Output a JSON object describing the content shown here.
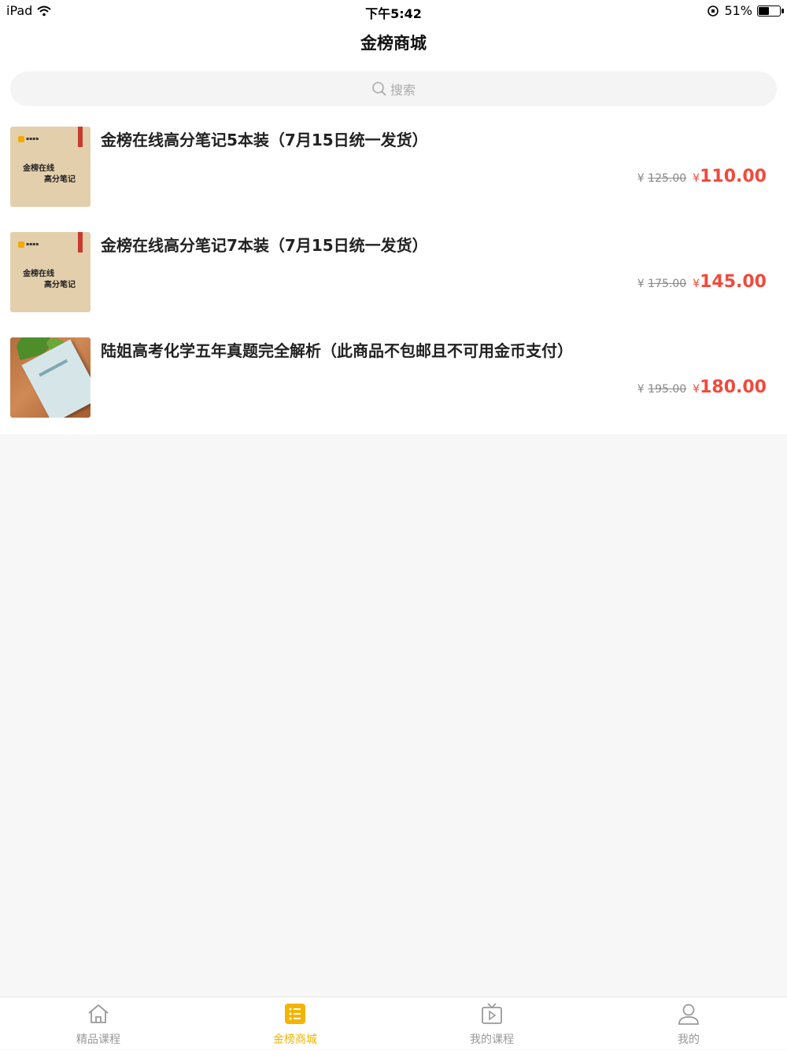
{
  "status_bar": {
    "device": "iPad",
    "time": "下午5:42",
    "battery": "51%",
    "battery_level": 0.51
  },
  "nav": {
    "title": "金榜商城"
  },
  "search": {
    "placeholder": "搜索"
  },
  "products": [
    {
      "title": "金榜在线高分笔记5本装（7月15日统一发货）",
      "currency": "¥",
      "old_price": "125.00",
      "price": "110.00",
      "thumb": {
        "line1": "金榜在线",
        "line2": "高分笔记"
      }
    },
    {
      "title": "金榜在线高分笔记7本装（7月15日统一发货）",
      "currency": "¥",
      "old_price": "175.00",
      "price": "145.00",
      "thumb": {
        "line1": "金榜在线",
        "line2": "高分笔记"
      }
    },
    {
      "title": "陆姐高考化学五年真题完全解析（此商品不包邮且不可用金币支付）",
      "currency": "¥",
      "old_price": "195.00",
      "price": "180.00"
    }
  ],
  "tabs": [
    {
      "label": "精品课程",
      "icon": "home-icon"
    },
    {
      "label": "金榜商城",
      "icon": "list-icon",
      "active": true
    },
    {
      "label": "我的课程",
      "icon": "video-icon"
    },
    {
      "label": "我的",
      "icon": "user-icon"
    }
  ],
  "colors": {
    "accent": "#f4b400",
    "price": "#f04a3c",
    "inactive": "#999999"
  }
}
